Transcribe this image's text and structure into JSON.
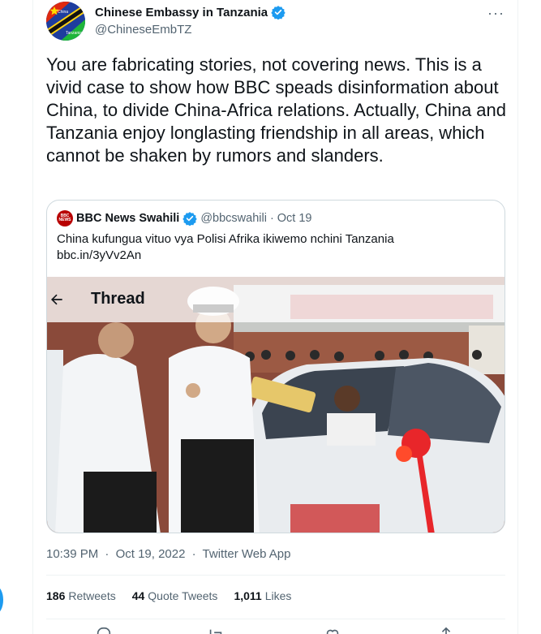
{
  "author": {
    "name": "Chinese Embassy in Tanzania",
    "handle": "@ChineseEmbTZ",
    "avatar_text_top": "China",
    "avatar_text_bottom": "Tanzania"
  },
  "more_label": "···",
  "tweet_text": "You are fabricating stories, not covering news. This is a vivid case to show how BBC speads disinformation about China, to divide China-Africa relations. Actually, China and Tanzania enjoy longlasting friendship in all areas, which cannot be shaken by rumors and slanders.",
  "quote": {
    "logo_line1": "BBC",
    "logo_line2": "NEWS",
    "name": "BBC News Swahili",
    "handle": "@bbcswahili",
    "dot": "·",
    "date": "Oct 19",
    "text": "China kufungua vituo vya Polisi Afrika ikiwemo nchini Tanzania",
    "link": "bbc.in/3yVv2An",
    "media_header_title": "Thread"
  },
  "meta": {
    "time": "10:39 PM",
    "sep1": "·",
    "date": "Oct 19, 2022",
    "sep2": "·",
    "source": "Twitter Web App"
  },
  "stats": [
    {
      "count": "186",
      "label": "Retweets"
    },
    {
      "count": "44",
      "label": "Quote Tweets"
    },
    {
      "count": "1,011",
      "label": "Likes"
    }
  ],
  "colors": {
    "verified": "#1d9bf0",
    "text": "#0f1419",
    "secondary": "#536471",
    "border": "#cfd9de",
    "bbc_red": "#b80000"
  },
  "icons": [
    "verified-badge-icon",
    "more-icon",
    "back-arrow-icon",
    "reply-icon",
    "retweet-icon",
    "like-icon",
    "share-icon"
  ]
}
